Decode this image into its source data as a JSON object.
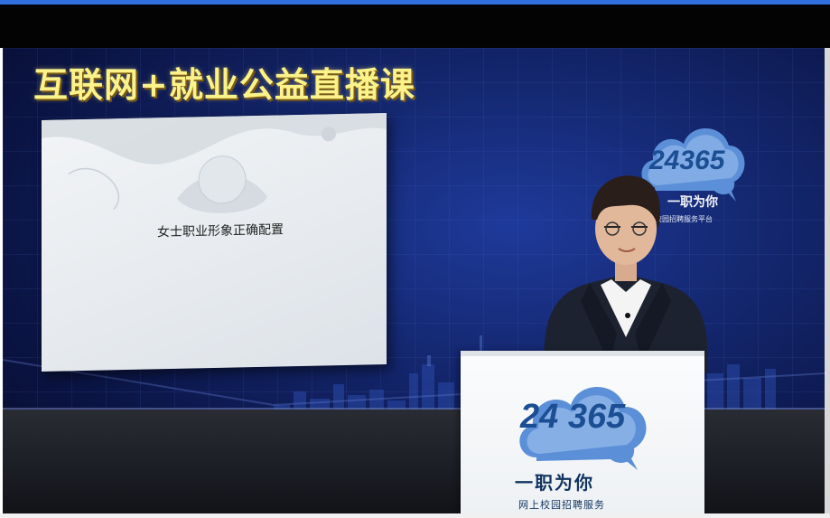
{
  "program": {
    "title": "互联网+就业公益直播课"
  },
  "slide": {
    "heading": "女士职业形象正确配置"
  },
  "wall_logo": {
    "number": "24365",
    "slogan": "一职为你",
    "subtitle": "校园招聘服务平台"
  },
  "podium_logo": {
    "number": "24 365",
    "slogan": "一职为你",
    "subtitle": "网上校园招聘服务"
  },
  "colors": {
    "title_yellow": "#fbf28a",
    "studio_blue": "#14276f",
    "brand_blue": "#1b4e92",
    "cloud_blue": "#5b8fd8",
    "top_bar": "#2f6fe0"
  }
}
